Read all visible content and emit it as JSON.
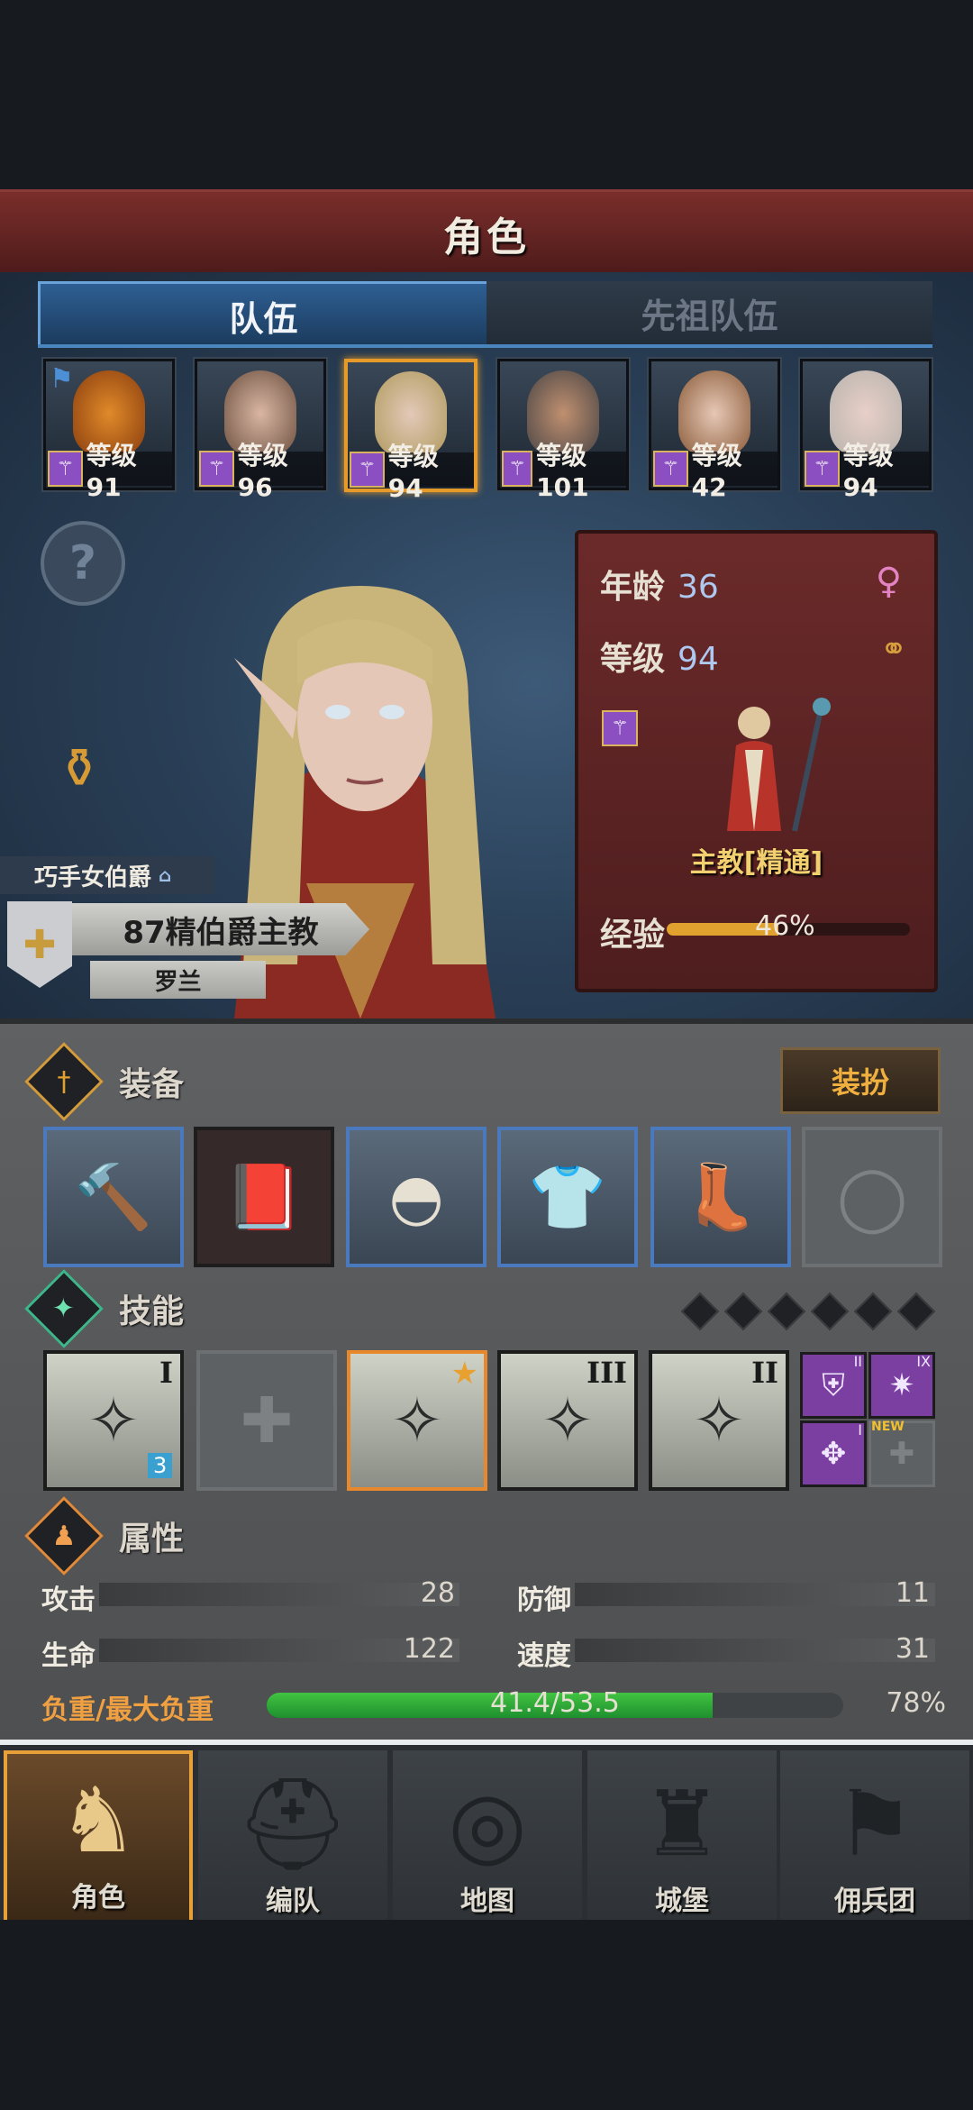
{
  "header": {
    "title": "角色"
  },
  "tabs": [
    {
      "label": "队伍"
    },
    {
      "label": "先祖队伍"
    }
  ],
  "party": [
    {
      "level_text": "等级91"
    },
    {
      "level_text": "等级96"
    },
    {
      "level_text": "等级94"
    },
    {
      "level_text": "等级101"
    },
    {
      "level_text": "等级42"
    },
    {
      "level_text": "等级94"
    }
  ],
  "stats_card": {
    "age_label": "年龄",
    "age": "36",
    "level_label": "等级",
    "level": "94",
    "class_name": "主教[精通]",
    "exp_label": "经验",
    "exp_pct_text": "46%",
    "exp_fraction": 0.46
  },
  "hero": {
    "trait": "巧手女伯爵",
    "title": "87精伯爵主教",
    "name": "罗兰"
  },
  "sections": {
    "equipment": "装备",
    "skills": "技能",
    "attributes": "属性"
  },
  "dress_button": "装扮",
  "skills_roman": [
    "I",
    "III",
    "II"
  ],
  "mini_skills_roman": [
    "II",
    "IX",
    "I"
  ],
  "skill_new_badge": "NEW",
  "skill_count_badge": "3",
  "attributes": [
    {
      "label": "攻击",
      "value": "28"
    },
    {
      "label": "防御",
      "value": "11"
    },
    {
      "label": "生命",
      "value": "122"
    },
    {
      "label": "速度",
      "value": "31"
    }
  ],
  "load": {
    "label": "负重/最大负重",
    "text": "41.4/53.5",
    "pct": "78%",
    "fraction": 0.774
  },
  "nav": [
    {
      "label": "角色"
    },
    {
      "label": "编队"
    },
    {
      "label": "地图"
    },
    {
      "label": "城堡"
    },
    {
      "label": "佣兵团"
    }
  ],
  "colors": {
    "accent": "#e8a038",
    "tab_active": "#2e5f93",
    "card": "#6b2a2a",
    "load_green": "#42c442"
  }
}
